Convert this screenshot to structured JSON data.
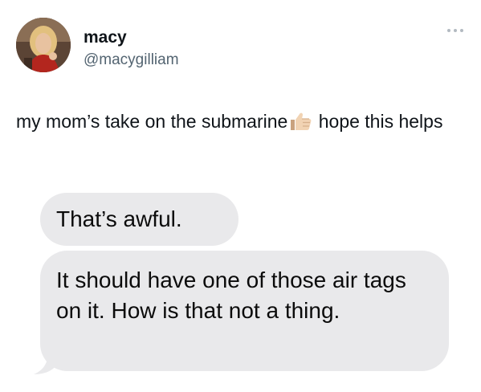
{
  "tweet": {
    "author": {
      "display_name": "macy",
      "handle": "@macygilliam",
      "avatar_icon": "profile-photo"
    },
    "more_icon": "more-horizontal-icon",
    "text_before_emoji": "my mom’s take on the submarine",
    "emoji_icon": "thumbs-up-light-skin-tone",
    "text_after_emoji": " hope this helps"
  },
  "messages": [
    {
      "text": "That’s awful."
    },
    {
      "text": "It should have one of those air tags on it. How is that not a thing."
    }
  ],
  "colors": {
    "text": "#0f1419",
    "secondary_text": "#536471",
    "bubble_background": "#e9e9eb"
  }
}
